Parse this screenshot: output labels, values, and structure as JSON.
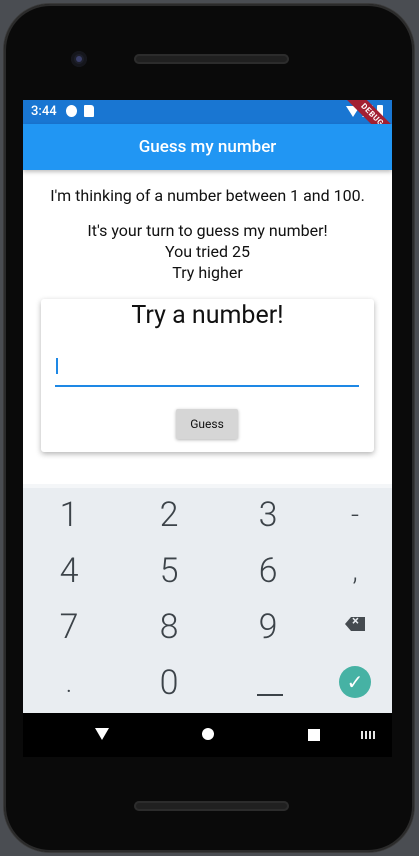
{
  "status_bar": {
    "time": "3:44"
  },
  "debug_banner": "DEBUG",
  "app_bar": {
    "title": "Guess my number"
  },
  "main": {
    "intro": "I'm thinking of a number between 1 and 100.",
    "turn_line": "It's your turn to guess my number!",
    "tried_line": "You tried 25",
    "hint_line": "Try higher"
  },
  "card": {
    "title": "Try a number!",
    "input_value": "",
    "button_label": "Guess"
  },
  "keyboard": {
    "keys": [
      "1",
      "2",
      "3",
      "-",
      "4",
      "5",
      "6",
      ",",
      "7",
      "8",
      "9",
      ".",
      "0"
    ]
  },
  "colors": {
    "status_bar": "#1976d2",
    "app_bar": "#2196f3",
    "accent": "#1e88e5",
    "keyboard_bg": "#e9edf1",
    "done_button": "#46b2a4",
    "debug_banner": "#a32033"
  }
}
